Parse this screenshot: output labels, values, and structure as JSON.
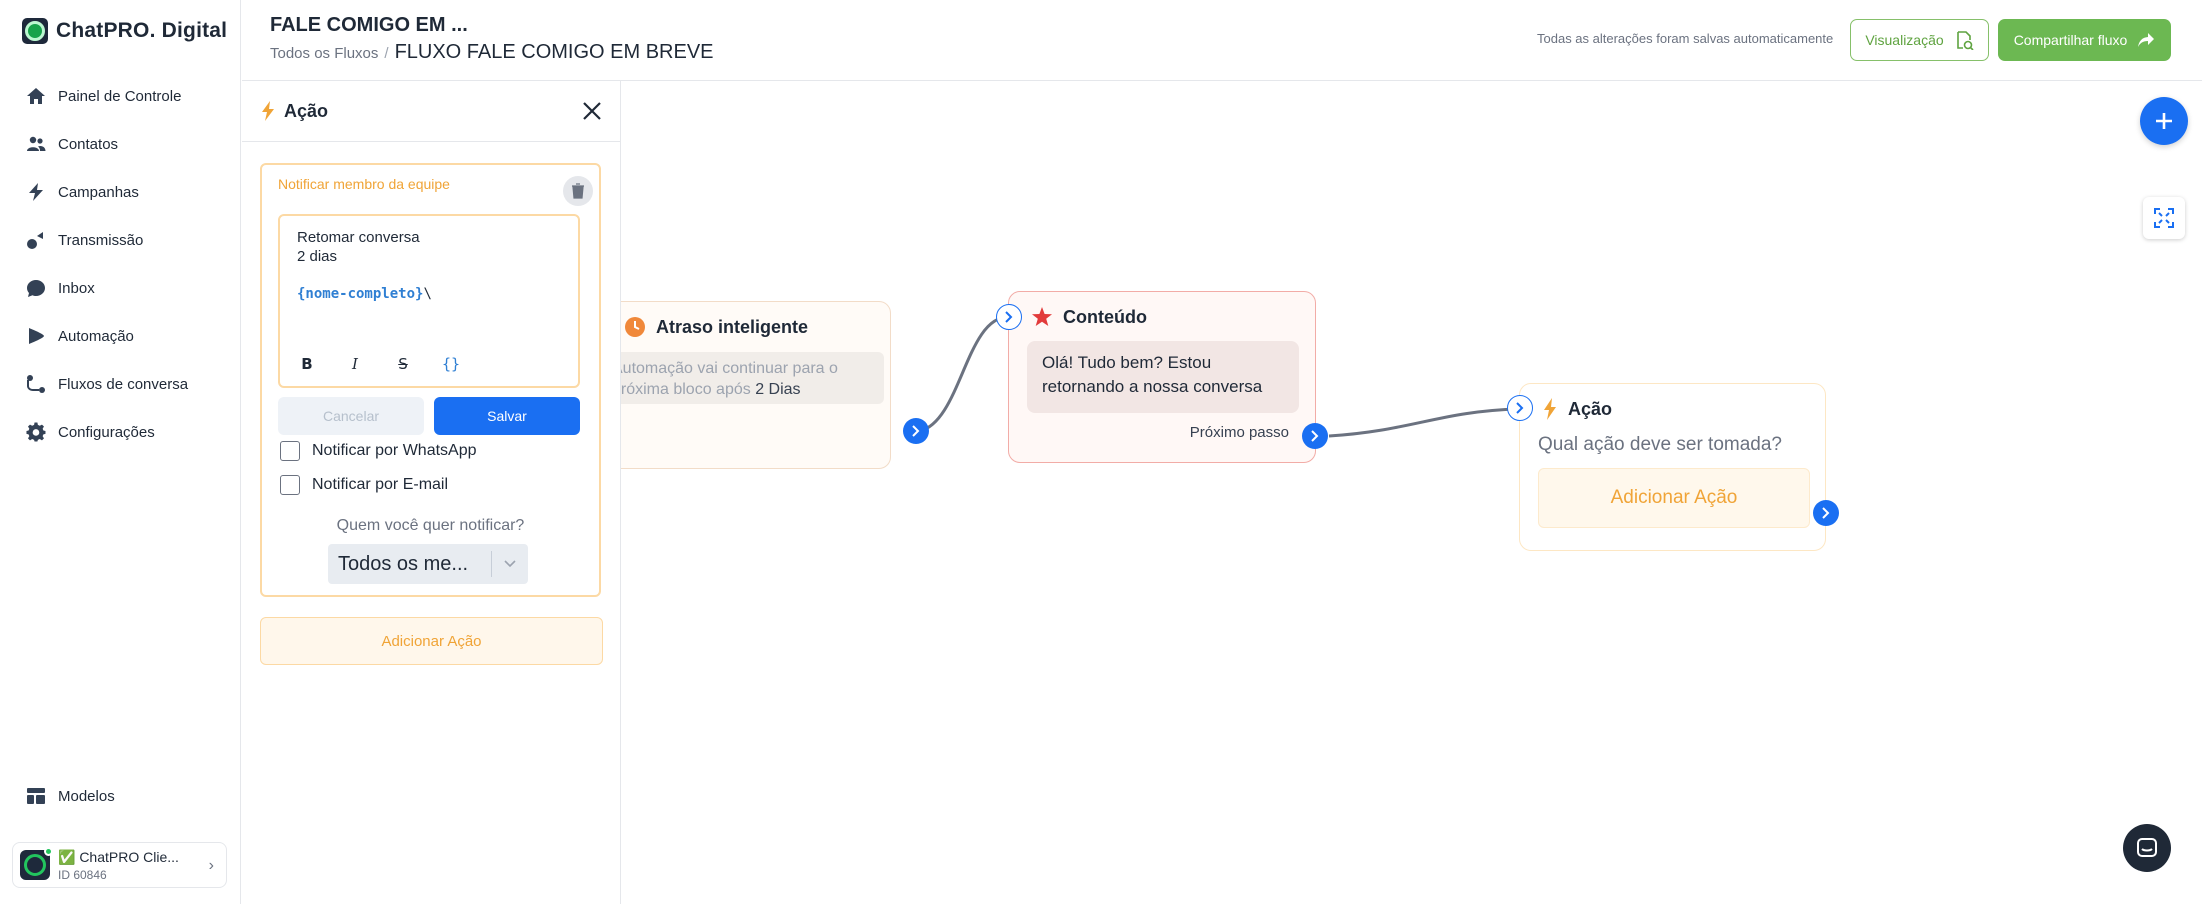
{
  "brand": {
    "name": "ChatPRO. Digital"
  },
  "sidebar": {
    "items": [
      {
        "label": "Painel de Controle",
        "icon": "home-icon"
      },
      {
        "label": "Contatos",
        "icon": "users-icon"
      },
      {
        "label": "Campanhas",
        "icon": "bolt-icon"
      },
      {
        "label": "Transmissão",
        "icon": "broadcast-icon"
      },
      {
        "label": "Inbox",
        "icon": "chat-bubble-icon"
      },
      {
        "label": "Automação",
        "icon": "play-icon"
      },
      {
        "label": "Fluxos de conversa",
        "icon": "flow-icon"
      },
      {
        "label": "Configurações",
        "icon": "gear-icon"
      }
    ],
    "bottom_items": [
      {
        "label": "Modelos",
        "icon": "templates-icon"
      }
    ],
    "account": {
      "name": "✅ ChatPRO Clie...",
      "id": "ID 60846"
    }
  },
  "header": {
    "title": "FALE COMIGO EM ...",
    "breadcrumb_root": "Todos os Fluxos",
    "breadcrumb_sep": "/",
    "breadcrumb_current": "FLUXO FALE COMIGO EM BREVE",
    "save_status": "Todas as alterações foram salvas automaticamente",
    "preview_label": "Visualização",
    "share_label": "Compartilhar fluxo"
  },
  "panel": {
    "title": "Ação",
    "card": {
      "title": "Notificar membro da equipe",
      "message_line1": "Retomar conversa",
      "message_line2": "2 dias",
      "variable": "{nome-completo}",
      "variable_suffix": "\\",
      "cancel_label": "Cancelar",
      "save_label": "Salvar",
      "whatsapp_label": "Notificar por WhatsApp",
      "email_label": "Notificar por E-mail",
      "notify_question": "Quem você quer notificar?",
      "notify_select_value": "Todos os me..."
    },
    "add_action_label": "Adicionar Ação"
  },
  "canvas": {
    "delay_node": {
      "title": "Atraso inteligente",
      "body_prefix": "Automação vai continuar para o próxima bloco após",
      "body_value": "2 Dias"
    },
    "content_node": {
      "title": "Conteúdo",
      "message": "Olá! Tudo bem? Estou retornando a nossa conversa",
      "next_step": "Próximo passo"
    },
    "action_node": {
      "title": "Ação",
      "question": "Qual ação deve ser tomada?",
      "add_action_label": "Adicionar Ação"
    }
  },
  "colors": {
    "primary_blue": "#1a6ff2",
    "accent_orange": "#f0a437",
    "brand_green": "#6cb852",
    "content_red": "#e23b3b"
  }
}
